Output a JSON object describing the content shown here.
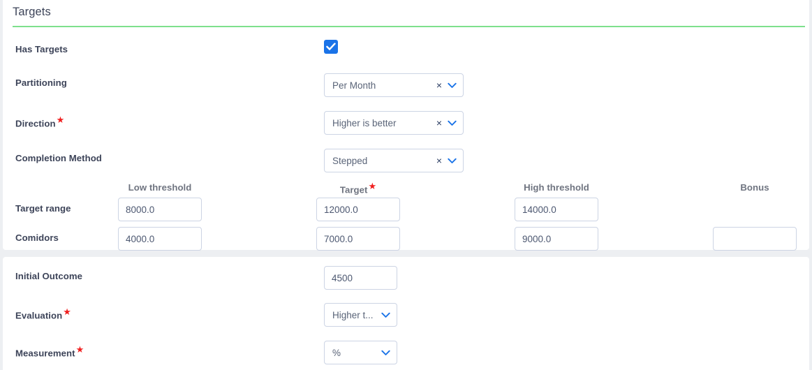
{
  "section": {
    "title": "Targets",
    "accent_rule_color": "#7ee08c"
  },
  "colors": {
    "checkbox_checked": "#1a73e8",
    "required_star": "#f01f1f",
    "label": "#3d4459",
    "column_header": "#6f7480",
    "input_border": "#ccd4e4",
    "input_text": "#4d5871",
    "panel_bg": "#ffffff",
    "page_bg": "#edeff2"
  },
  "targets": {
    "has_targets": {
      "label": "Has Targets",
      "checked": true,
      "icon": "check-icon"
    },
    "partitioning": {
      "label": "Partitioning",
      "value": "Per Month",
      "required": false,
      "clearable": true,
      "clear_icon": "close-icon",
      "chevron_icon": "chevron-down-icon"
    },
    "direction": {
      "label": "Direction",
      "value": "Higher is better",
      "required": true,
      "clearable": true,
      "clear_icon": "close-icon",
      "chevron_icon": "chevron-down-icon"
    },
    "completion_method": {
      "label": "Completion Method",
      "value": "Stepped",
      "required": false,
      "clearable": true,
      "clear_icon": "close-icon",
      "chevron_icon": "chevron-down-icon"
    },
    "grid": {
      "columns": [
        {
          "label": "Low threshold",
          "required": false
        },
        {
          "label": "Target",
          "required": true
        },
        {
          "label": "High threshold",
          "required": false
        },
        {
          "label": "Bonus",
          "required": false
        }
      ],
      "rows": [
        {
          "label": "Target range",
          "cells": [
            {
              "value": "8000.0",
              "placeholder": "",
              "present": true
            },
            {
              "value": "12000.0",
              "placeholder": "",
              "present": true
            },
            {
              "value": "14000.0",
              "placeholder": "",
              "present": true
            },
            {
              "value": "",
              "placeholder": "",
              "present": false
            }
          ]
        },
        {
          "label": "Comidors",
          "cells": [
            {
              "value": "4000.0",
              "placeholder": "",
              "present": true
            },
            {
              "value": "7000.0",
              "placeholder": "",
              "present": true
            },
            {
              "value": "9000.0",
              "placeholder": "",
              "present": true
            },
            {
              "value": "",
              "placeholder": "",
              "present": true
            }
          ]
        }
      ]
    }
  },
  "outcome": {
    "initial_outcome": {
      "label": "Initial Outcome",
      "value": "4500",
      "placeholder": "",
      "required": false
    },
    "evaluation": {
      "label": "Evaluation",
      "value": "Higher t...",
      "required": true,
      "clearable": false,
      "chevron_icon": "chevron-down-icon"
    },
    "measurement": {
      "label": "Measurement",
      "value": "%",
      "required": true,
      "clearable": false,
      "chevron_icon": "chevron-down-icon"
    }
  }
}
